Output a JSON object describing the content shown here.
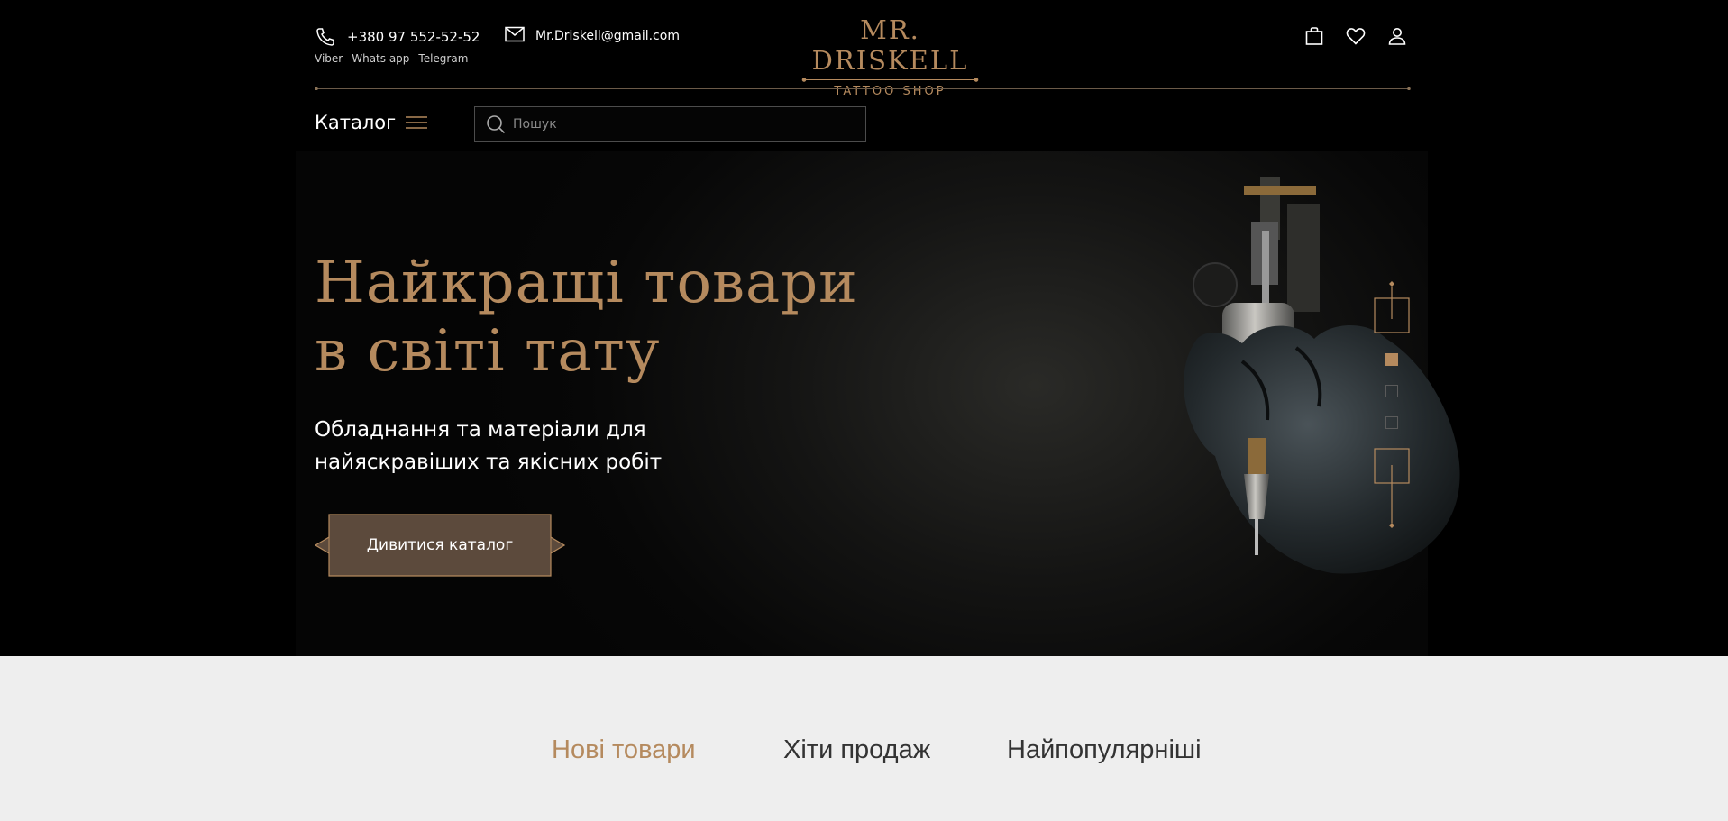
{
  "header": {
    "phone": "+380 97 552-52-52",
    "messengers": [
      "Viber",
      "Whats app",
      "Telegram"
    ],
    "email": "Mr.Driskell@gmail.com",
    "logo_main": "MR. DRISKELL",
    "logo_sub": "TATTOO SHOP",
    "icons": [
      "shopping-bag-icon",
      "heart-icon",
      "user-icon"
    ]
  },
  "nav": {
    "catalog_label": "Каталог",
    "search_placeholder": "Пошук"
  },
  "hero": {
    "title_line1": "Найкращі товари",
    "title_line2": "в світі тату",
    "subtitle_line1": "Обладнання та матеріали для",
    "subtitle_line2": "найяскравіших та якісних робіт",
    "cta_label": "Дивитися каталог",
    "slides_total": 3,
    "active_slide": 1
  },
  "tabs": [
    {
      "label": "Нові товари",
      "active": true
    },
    {
      "label": "Хіти продаж",
      "active": false
    },
    {
      "label": "Найпопулярніші",
      "active": false
    }
  ],
  "colors": {
    "accent": "#b58a5e",
    "background": "#000000",
    "section_bg": "#eeeeee",
    "button_fill": "#5c4a3c"
  }
}
